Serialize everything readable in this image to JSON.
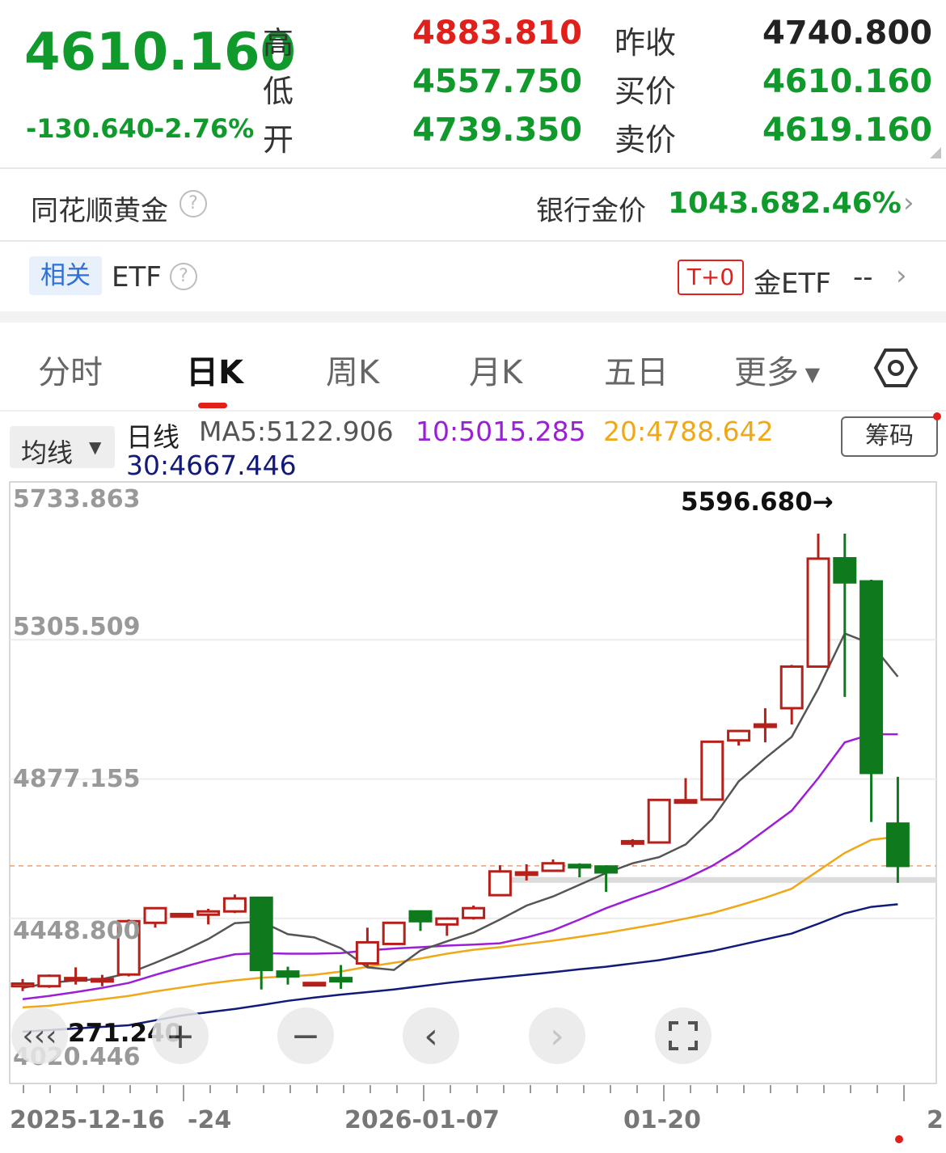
{
  "quote": {
    "last": "4610.160",
    "change": "-130.640",
    "change_pct": "-2.76%",
    "labels": {
      "high": "高",
      "low": "低",
      "open": "开",
      "prev_close": "昨收",
      "bid": "买价",
      "ask": "卖价"
    },
    "high": "4883.810",
    "low": "4557.750",
    "open": "4739.350",
    "prev_close": "4740.800",
    "bid": "4610.160",
    "ask": "4619.160"
  },
  "gold_row": {
    "title": "同花顺黄金",
    "help_icon": "question-circle-icon",
    "bank_label": "银行金价",
    "bank_price": "1043.68",
    "bank_pct": "-2.46%"
  },
  "etf_row": {
    "tag": "相关",
    "label": "ETF",
    "badge": "T+0",
    "name": "金ETF",
    "value": "--"
  },
  "tabs": [
    {
      "label": "分时"
    },
    {
      "label": "日K"
    },
    {
      "label": "周K"
    },
    {
      "label": "月K"
    },
    {
      "label": "五日"
    },
    {
      "label": "更多"
    }
  ],
  "indicators": {
    "dropdown": "均线",
    "line_type": "日线",
    "ma5": "MA5:5122.906",
    "ma10": "10:5015.285",
    "ma20": "20:4788.642",
    "ma30": "30:4667.446",
    "chips_button": "筹码",
    "colors": {
      "ma5": "#555555",
      "ma10": "#9b1fd6",
      "ma20": "#f0a818",
      "ma30": "#121a7a"
    }
  },
  "chart_data": {
    "type": "candlestick",
    "y_ticks": [
      "5733.863",
      "5305.509",
      "4877.155",
      "4448.800",
      "4020.446"
    ],
    "ylim": [
      4020.446,
      5733.863
    ],
    "max_marker": "5596.680→",
    "min_marker": "271.240",
    "x_ticks": [
      "2025-12-16",
      "-24",
      "2026-01-07",
      "01-20",
      "2"
    ],
    "reference_price": 4610.16,
    "candles": [
      {
        "o": 4240,
        "c": 4248,
        "h": 4262,
        "l": 4225
      },
      {
        "o": 4240,
        "c": 4272,
        "h": 4276,
        "l": 4235
      },
      {
        "o": 4262,
        "c": 4265,
        "h": 4298,
        "l": 4245
      },
      {
        "o": 4258,
        "c": 4262,
        "h": 4275,
        "l": 4240
      },
      {
        "o": 4276,
        "c": 4440,
        "h": 4445,
        "l": 4270
      },
      {
        "o": 4435,
        "c": 4480,
        "h": 4482,
        "l": 4420
      },
      {
        "o": 4460,
        "c": 4462,
        "h": 4465,
        "l": 4455
      },
      {
        "o": 4460,
        "c": 4470,
        "h": 4478,
        "l": 4430
      },
      {
        "o": 4470,
        "c": 4510,
        "h": 4522,
        "l": 4465
      },
      {
        "o": 4512,
        "c": 4290,
        "h": 4512,
        "l": 4230
      },
      {
        "o": 4285,
        "c": 4270,
        "h": 4300,
        "l": 4245
      },
      {
        "o": 4248,
        "c": 4250,
        "h": 4252,
        "l": 4245
      },
      {
        "o": 4265,
        "c": 4255,
        "h": 4305,
        "l": 4232
      },
      {
        "o": 4310,
        "c": 4375,
        "h": 4420,
        "l": 4300
      },
      {
        "o": 4370,
        "c": 4435,
        "h": 4438,
        "l": 4368
      },
      {
        "o": 4470,
        "c": 4440,
        "h": 4472,
        "l": 4410
      },
      {
        "o": 4430,
        "c": 4448,
        "h": 4452,
        "l": 4395
      },
      {
        "o": 4450,
        "c": 4480,
        "h": 4488,
        "l": 4445
      },
      {
        "o": 4520,
        "c": 4593,
        "h": 4612,
        "l": 4518
      },
      {
        "o": 4588,
        "c": 4590,
        "h": 4615,
        "l": 4565
      },
      {
        "o": 4595,
        "c": 4618,
        "h": 4630,
        "l": 4592
      },
      {
        "o": 4613,
        "c": 4610,
        "h": 4618,
        "l": 4575
      },
      {
        "o": 4608,
        "c": 4590,
        "h": 4612,
        "l": 4530
      },
      {
        "o": 4680,
        "c": 4686,
        "h": 4692,
        "l": 4668
      },
      {
        "o": 4682,
        "c": 4813,
        "h": 4815,
        "l": 4680
      },
      {
        "o": 4806,
        "c": 4812,
        "h": 4880,
        "l": 4805
      },
      {
        "o": 4814,
        "c": 4992,
        "h": 4992,
        "l": 4812
      },
      {
        "o": 4996,
        "c": 5025,
        "h": 5028,
        "l": 4980
      },
      {
        "o": 5040,
        "c": 5045,
        "h": 5095,
        "l": 4990
      },
      {
        "o": 5095,
        "c": 5223,
        "h": 5228,
        "l": 5045
      },
      {
        "o": 5223,
        "c": 5555,
        "h": 5632,
        "l": 5223
      },
      {
        "o": 5556,
        "c": 5482,
        "h": 5632,
        "l": 5130
      },
      {
        "o": 5485,
        "c": 4896,
        "h": 5490,
        "l": 4745
      },
      {
        "o": 4740,
        "c": 4610,
        "h": 4884,
        "l": 4558
      }
    ],
    "ma_lines": {
      "ma5": [
        4235,
        4250,
        4258,
        4262,
        4280,
        4312,
        4346,
        4385,
        4434,
        4439,
        4400,
        4390,
        4357,
        4298,
        4290,
        4350,
        4378,
        4405,
        4445,
        4488,
        4516,
        4552,
        4588,
        4618,
        4637,
        4676,
        4754,
        4870,
        4941,
        5007,
        5155,
        5325,
        5293,
        5192
      ],
      "ma10": [
        4200,
        4210,
        4222,
        4235,
        4250,
        4275,
        4298,
        4320,
        4338,
        4342,
        4340,
        4340,
        4342,
        4350,
        4356,
        4360,
        4365,
        4368,
        4372,
        4390,
        4412,
        4445,
        4480,
        4510,
        4538,
        4570,
        4610,
        4660,
        4720,
        4780,
        4880,
        4990,
        5015,
        5015
      ],
      "ma20": [
        4175,
        4180,
        4190,
        4200,
        4210,
        4224,
        4236,
        4248,
        4258,
        4266,
        4270,
        4275,
        4285,
        4300,
        4312,
        4325,
        4340,
        4352,
        4360,
        4370,
        4380,
        4392,
        4404,
        4418,
        4432,
        4448,
        4465,
        4488,
        4512,
        4540,
        4595,
        4650,
        4690,
        4700
      ],
      "ma30": [
        4100,
        4105,
        4110,
        4115,
        4120,
        4135,
        4150,
        4160,
        4170,
        4182,
        4195,
        4205,
        4214,
        4222,
        4230,
        4240,
        4250,
        4259,
        4267,
        4275,
        4283,
        4292,
        4300,
        4310,
        4320,
        4334,
        4348,
        4366,
        4384,
        4402,
        4432,
        4464,
        4484,
        4492
      ]
    }
  }
}
